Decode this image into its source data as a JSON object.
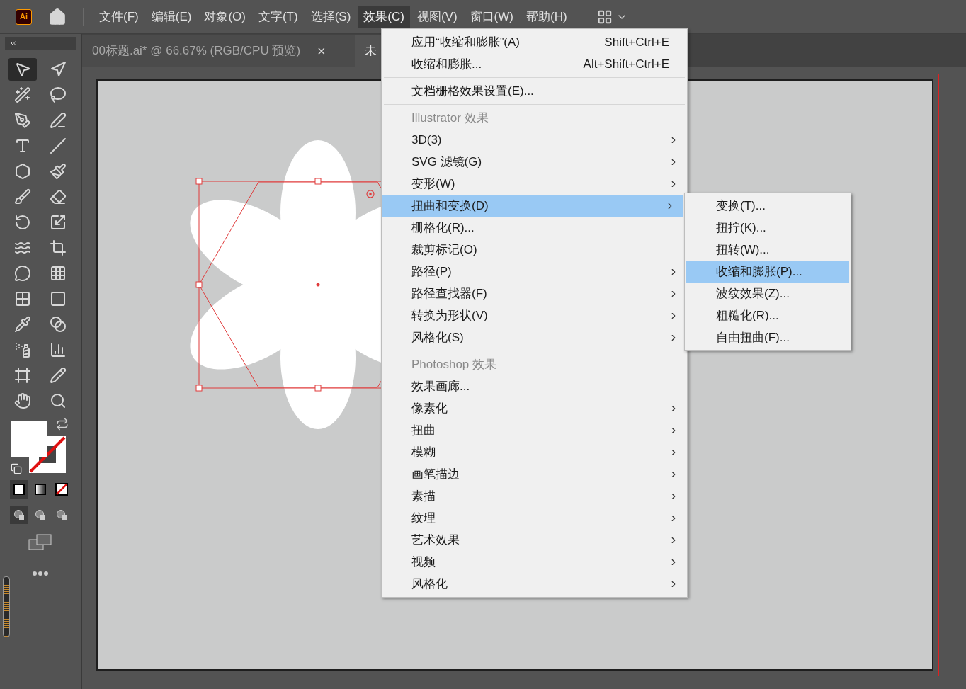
{
  "app_logo": "Ai",
  "menubar": [
    {
      "label": "文件(F)",
      "selected": false
    },
    {
      "label": "编辑(E)",
      "selected": false
    },
    {
      "label": "对象(O)",
      "selected": false
    },
    {
      "label": "文字(T)",
      "selected": false
    },
    {
      "label": "选择(S)",
      "selected": false
    },
    {
      "label": "效果(C)",
      "selected": true
    },
    {
      "label": "视图(V)",
      "selected": false
    },
    {
      "label": "窗口(W)",
      "selected": false
    },
    {
      "label": "帮助(H)",
      "selected": false
    }
  ],
  "tabs": [
    {
      "label": "00标题.ai* @ 66.67% (RGB/CPU 预览)",
      "close": "×",
      "selected": true
    },
    {
      "label": "未",
      "selected": false
    }
  ],
  "effect_menu": {
    "items": [
      {
        "kind": "item",
        "label": "应用“收缩和膨胀”(A)",
        "shortcut": "Shift+Ctrl+E",
        "has_submenu": false,
        "selected": false
      },
      {
        "kind": "item",
        "label": "收缩和膨胀...",
        "shortcut": "Alt+Shift+Ctrl+E",
        "has_submenu": false,
        "selected": false
      },
      {
        "kind": "separator"
      },
      {
        "kind": "item",
        "label": "文档栅格效果设置(E)...",
        "has_submenu": false,
        "selected": false
      },
      {
        "kind": "separator"
      },
      {
        "kind": "header",
        "label": "Illustrator 效果"
      },
      {
        "kind": "item",
        "label": "3D(3)",
        "has_submenu": true,
        "selected": false
      },
      {
        "kind": "item",
        "label": "SVG 滤镜(G)",
        "has_submenu": true,
        "selected": false
      },
      {
        "kind": "item",
        "label": "变形(W)",
        "has_submenu": true,
        "selected": false
      },
      {
        "kind": "item",
        "label": "扭曲和变换(D)",
        "has_submenu": true,
        "selected": true
      },
      {
        "kind": "item",
        "label": "栅格化(R)...",
        "has_submenu": false,
        "selected": false
      },
      {
        "kind": "item",
        "label": "裁剪标记(O)",
        "has_submenu": false,
        "selected": false
      },
      {
        "kind": "item",
        "label": "路径(P)",
        "has_submenu": true,
        "selected": false
      },
      {
        "kind": "item",
        "label": "路径查找器(F)",
        "has_submenu": true,
        "selected": false
      },
      {
        "kind": "item",
        "label": "转换为形状(V)",
        "has_submenu": true,
        "selected": false
      },
      {
        "kind": "item",
        "label": "风格化(S)",
        "has_submenu": true,
        "selected": false
      },
      {
        "kind": "separator"
      },
      {
        "kind": "header",
        "label": "Photoshop 效果"
      },
      {
        "kind": "item",
        "label": "效果画廊...",
        "has_submenu": false,
        "selected": false
      },
      {
        "kind": "item",
        "label": "像素化",
        "has_submenu": true,
        "selected": false
      },
      {
        "kind": "item",
        "label": "扭曲",
        "has_submenu": true,
        "selected": false
      },
      {
        "kind": "item",
        "label": "模糊",
        "has_submenu": true,
        "selected": false
      },
      {
        "kind": "item",
        "label": "画笔描边",
        "has_submenu": true,
        "selected": false
      },
      {
        "kind": "item",
        "label": "素描",
        "has_submenu": true,
        "selected": false
      },
      {
        "kind": "item",
        "label": "纹理",
        "has_submenu": true,
        "selected": false
      },
      {
        "kind": "item",
        "label": "艺术效果",
        "has_submenu": true,
        "selected": false
      },
      {
        "kind": "item",
        "label": "视频",
        "has_submenu": true,
        "selected": false
      },
      {
        "kind": "item",
        "label": "风格化",
        "has_submenu": true,
        "selected": false
      }
    ]
  },
  "submenu": {
    "items": [
      {
        "label": "变换(T)...",
        "selected": false
      },
      {
        "label": "扭拧(K)...",
        "selected": false
      },
      {
        "label": "扭转(W)...",
        "selected": false
      },
      {
        "label": "收缩和膨胀(P)...",
        "selected": true
      },
      {
        "label": "波纹效果(Z)...",
        "selected": false
      },
      {
        "label": "粗糙化(R)...",
        "selected": false
      },
      {
        "label": "自由扭曲(F)...",
        "selected": false
      }
    ]
  }
}
